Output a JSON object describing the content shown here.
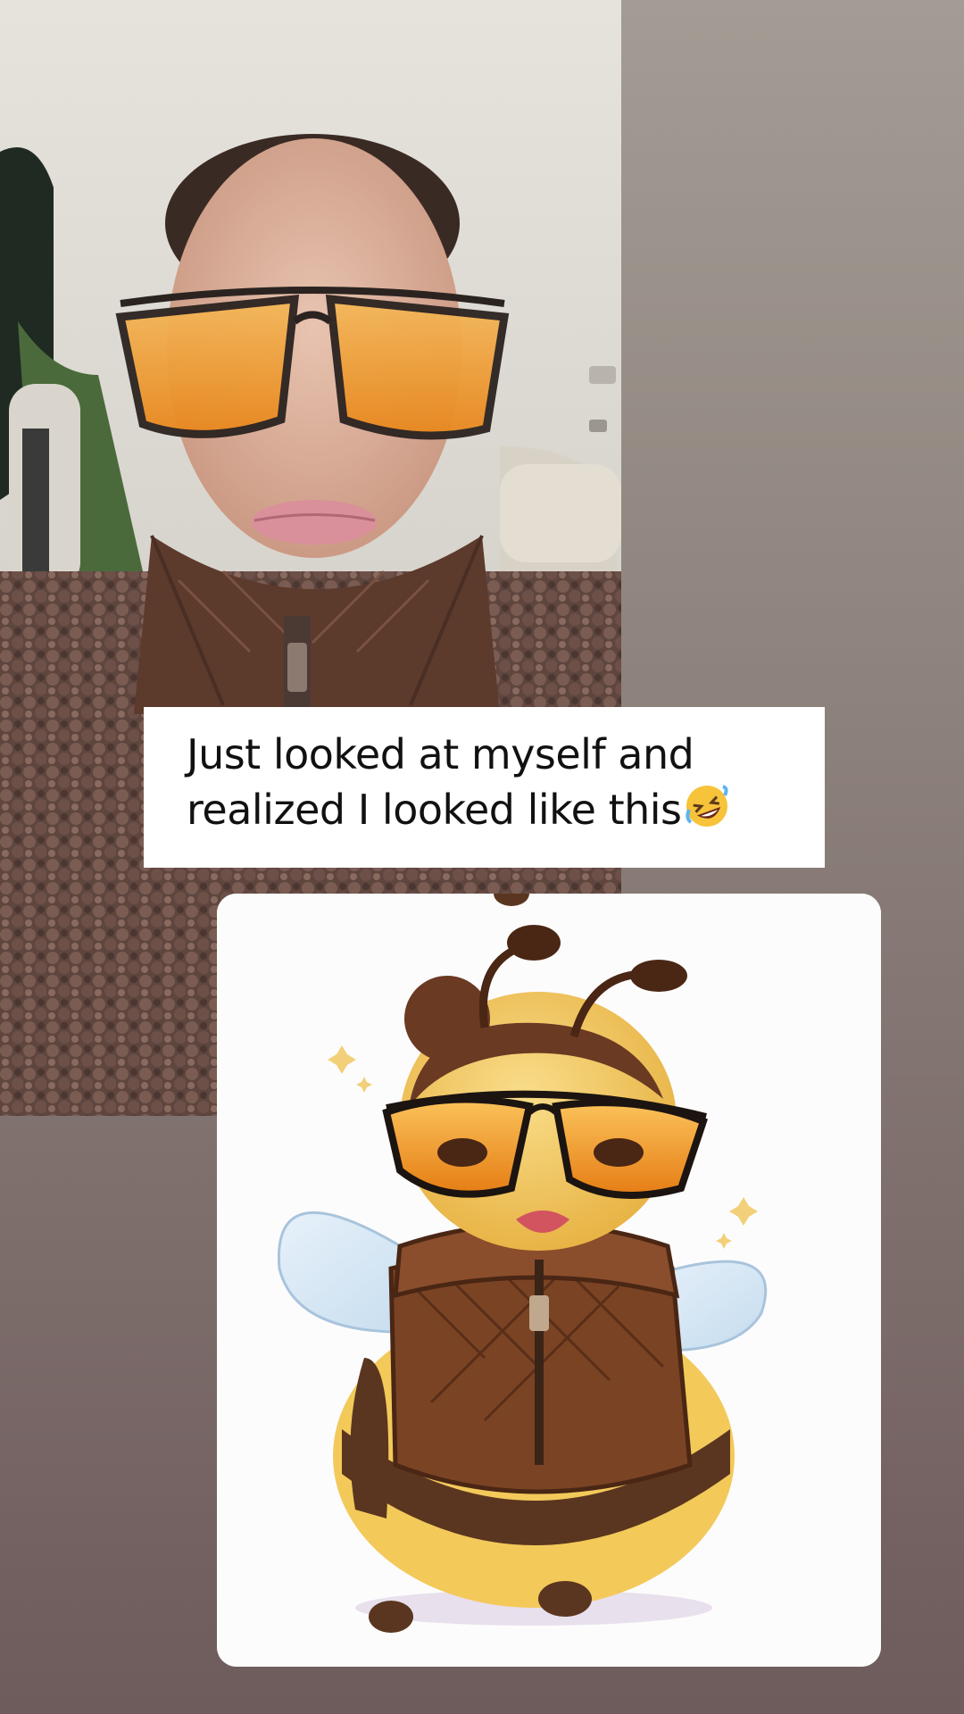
{
  "story": {
    "background_colors": [
      "#a39c94",
      "#6e5b5c"
    ],
    "photo": {
      "icon": "selfie-photo",
      "description_name": "selfie-in-car"
    },
    "caption": {
      "line1": "Just looked at myself and",
      "line2": "realized I looked like this",
      "emoji_icon": "rolling-on-floor-laughing-emoji"
    },
    "sticker": {
      "icon": "bee-illustration",
      "accent_colors": [
        "#f2a01e",
        "#6b3a22",
        "#f3c95a"
      ]
    }
  }
}
